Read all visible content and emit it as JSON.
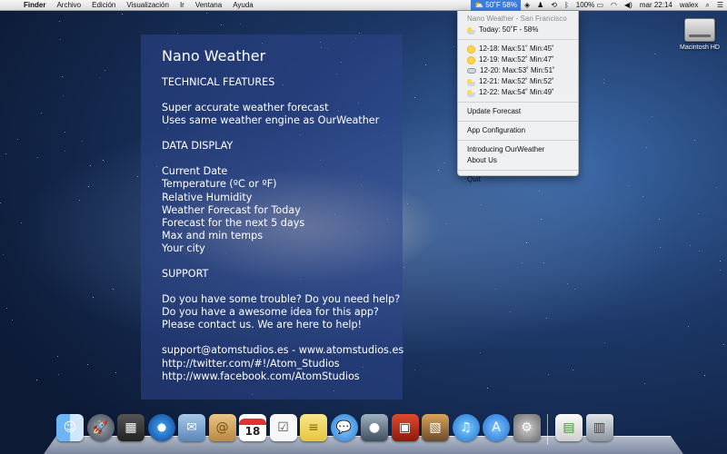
{
  "menubar": {
    "apple_icon": "apple-logo-icon",
    "items": [
      {
        "label": "Finder",
        "bold": true
      },
      {
        "label": "Archivo"
      },
      {
        "label": "Edición"
      },
      {
        "label": "Visualización"
      },
      {
        "label": "Ir"
      },
      {
        "label": "Ventana"
      },
      {
        "label": "Ayuda"
      }
    ],
    "weather_status": "50˚F 58%",
    "battery": "100%",
    "clock": "mar 22:14",
    "user": "walex"
  },
  "desktop": {
    "drive_label": "Macintosh HD"
  },
  "panel": {
    "title": "Nano Weather",
    "tech_heading": "TECHNICAL FEATURES",
    "tech_lines": [
      "Super accurate weather forecast",
      "Uses same weather engine as OurWeather"
    ],
    "display_heading": "DATA DISPLAY",
    "display_lines": [
      "Current Date",
      "Temperature (ºC or ºF)",
      "Relative Humidity",
      "Weather Forecast for Today",
      "Forecast for the next 5 days",
      "Max and min temps",
      "Your city"
    ],
    "support_heading": "SUPPORT",
    "support_lines": [
      "Do you have some trouble? Do you need help?",
      "Do you have a awesome idea for this app?",
      "Please contact us. We are here to help!"
    ],
    "contact_lines": [
      "support@atomstudios.es - www.atomstudios.es",
      "http://twitter.com/#!/Atom_Studios",
      "http://www.facebook.com/AtomStudios"
    ]
  },
  "dropdown": {
    "header": "Nano Weather - San Francisco",
    "today": "Today: 50˚F - 58%",
    "forecast": [
      {
        "text": "12-18: Max:51˚ Min:45˚",
        "icon": "sun"
      },
      {
        "text": "12-19: Max:52˚ Min:47˚",
        "icon": "sun"
      },
      {
        "text": "12-20: Max:53˚ Min:51˚",
        "icon": "cloud"
      },
      {
        "text": "12-21: Max:52˚ Min:52˚",
        "icon": "partly"
      },
      {
        "text": "12-22: Max:54˚ Min:49˚",
        "icon": "partly"
      }
    ],
    "update": "Update Forecast",
    "config": "App Configuration",
    "intro": "Introducing OurWeather",
    "about": "About Us",
    "quit": "Quit"
  },
  "dock": {
    "calendar_day": "18",
    "apps": [
      "finder",
      "launchpad",
      "mission-control",
      "safari",
      "mail",
      "contacts",
      "calendar",
      "reminders",
      "notes",
      "messages",
      "facetime",
      "photo-booth",
      "iphoto",
      "itunes",
      "app-store",
      "system-preferences"
    ],
    "colors": {
      "finder": "#4a90e2",
      "safari": "#2a7fd4",
      "itunes": "#1e88e5",
      "appstore": "#2f8ae0"
    }
  }
}
